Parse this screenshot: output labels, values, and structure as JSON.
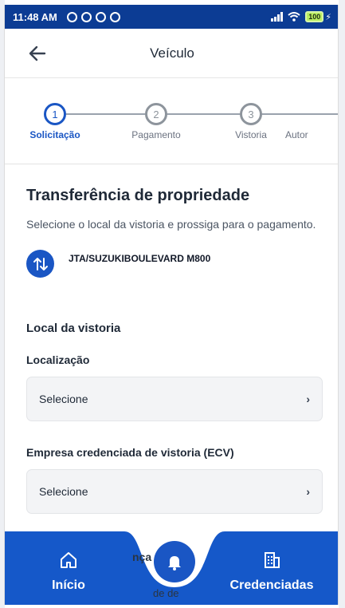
{
  "status_bar": {
    "time": "11:48 AM",
    "battery": "100"
  },
  "header": {
    "title": "Veículo",
    "back_icon": "arrow-left-icon"
  },
  "stepper": {
    "steps": [
      {
        "number": "1",
        "label": "Solicitação",
        "active": true
      },
      {
        "number": "2",
        "label": "Pagamento",
        "active": false
      },
      {
        "number": "3",
        "label": "Vistoria",
        "active": false
      },
      {
        "number": "",
        "label": "Autor",
        "active": false
      }
    ]
  },
  "main": {
    "title": "Transferência de propriedade",
    "subtitle": "Selecione o local da vistoria e prossiga para o pagamento.",
    "vehicle": "JTA/SUZUKIBOULEVARD M800",
    "section_title": "Local da vistoria",
    "location_label": "Localização",
    "location_value": "Selecione",
    "ecv_label": "Empresa credenciada de vistoria (ECV)",
    "ecv_value": "Selecione"
  },
  "bottom_nav": {
    "home_label": "Início",
    "credenciadas_label": "Credenciadas",
    "behind_text_1": "nça",
    "behind_text_2": "de de"
  },
  "colors": {
    "primary": "#1a56c4",
    "status_bar": "#0c3c94",
    "nav": "#1558c9"
  }
}
